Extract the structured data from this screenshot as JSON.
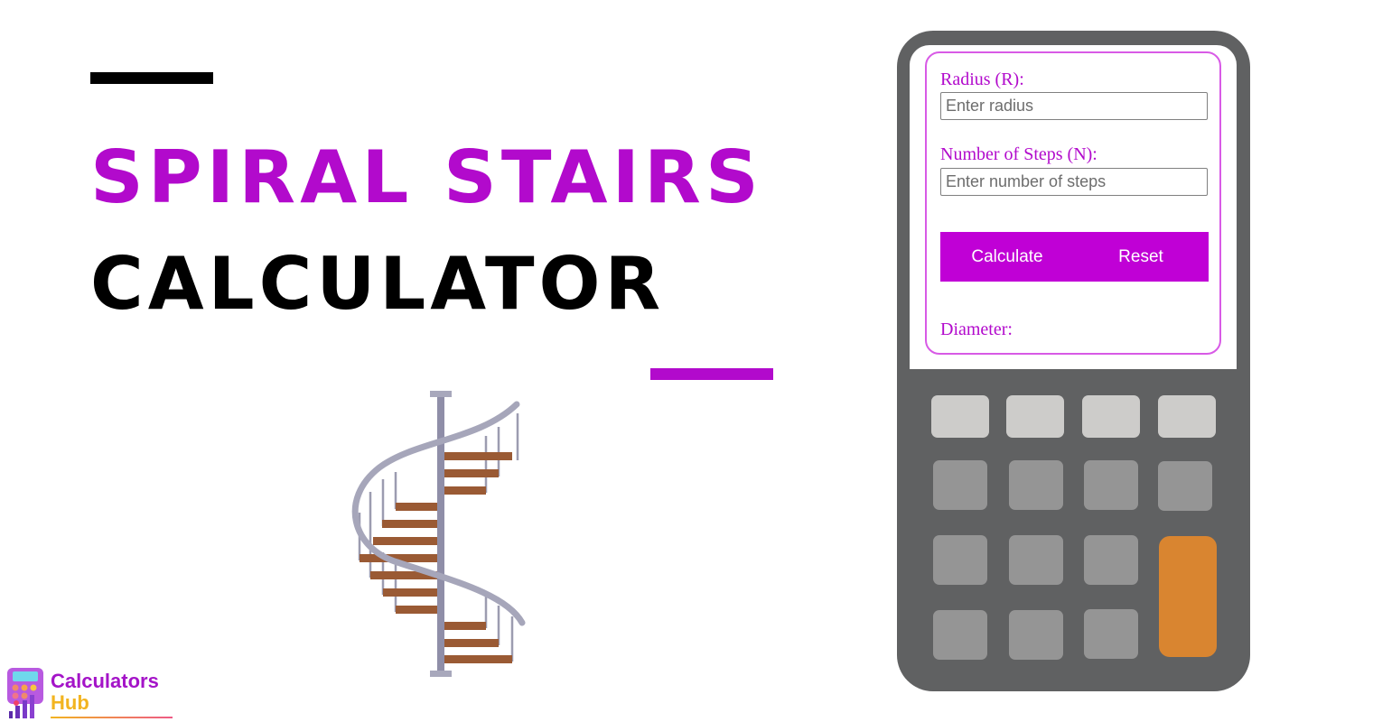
{
  "title": {
    "line1": "Spiral Stairs",
    "line2": "Calculator"
  },
  "colors": {
    "accent": "#b20acc",
    "button": "#c000d6",
    "calculator_body": "#606162",
    "key_light": "#cdccca",
    "key_mid": "#959595",
    "key_orange": "#d98530"
  },
  "form": {
    "radius_label": "Radius (R):",
    "radius_placeholder": "Enter radius",
    "radius_value": "",
    "steps_label": "Number of Steps (N):",
    "steps_placeholder": "Enter number of steps",
    "steps_value": "",
    "calculate_label": "Calculate",
    "reset_label": "Reset",
    "result_label": "Diameter:"
  },
  "logo": {
    "line1": "Calculators",
    "line2": "Hub"
  },
  "illustration": "spiral-staircase-icon"
}
